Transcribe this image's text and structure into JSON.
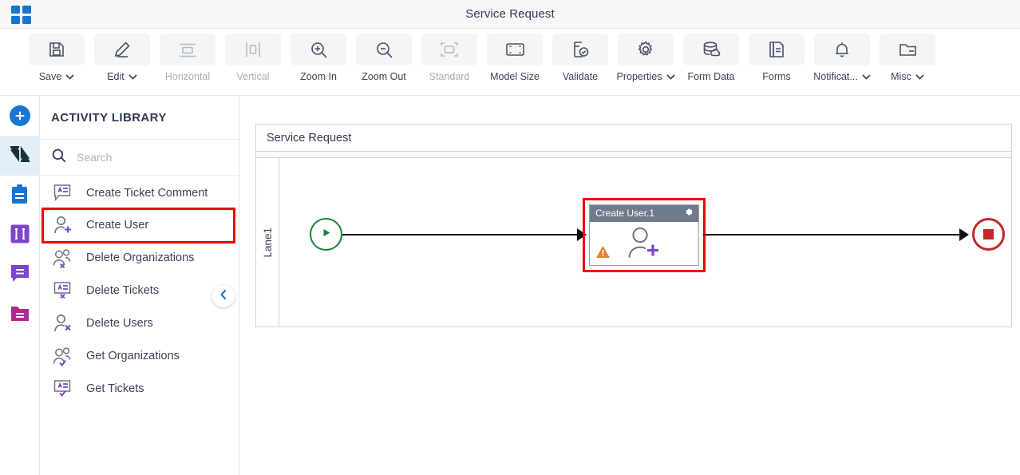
{
  "titlebar": {
    "title": "Service Request",
    "apps_icon": "apps-grid-icon"
  },
  "toolbar": {
    "buttons": [
      {
        "label": "Save",
        "icon": "save-floppy-icon",
        "dropdown": true,
        "disabled": false
      },
      {
        "label": "Edit",
        "icon": "pencil-edit-icon",
        "dropdown": true,
        "disabled": false
      },
      {
        "label": "Horizontal",
        "icon": "horizontal-align-icon",
        "dropdown": false,
        "disabled": true
      },
      {
        "label": "Vertical",
        "icon": "vertical-align-icon",
        "dropdown": false,
        "disabled": true
      },
      {
        "label": "Zoom In",
        "icon": "zoom-in-icon",
        "dropdown": false,
        "disabled": false
      },
      {
        "label": "Zoom Out",
        "icon": "zoom-out-icon",
        "dropdown": false,
        "disabled": false
      },
      {
        "label": "Standard",
        "icon": "standard-size-icon",
        "dropdown": false,
        "disabled": true
      },
      {
        "label": "Model Size",
        "icon": "model-size-icon",
        "dropdown": false,
        "disabled": false
      },
      {
        "label": "Validate",
        "icon": "validate-doc-icon",
        "dropdown": false,
        "disabled": false
      },
      {
        "label": "Properties",
        "icon": "gear-icon",
        "dropdown": true,
        "disabled": false
      },
      {
        "label": "Form Data",
        "icon": "database-icon",
        "dropdown": false,
        "disabled": false
      },
      {
        "label": "Forms",
        "icon": "document-icon",
        "dropdown": false,
        "disabled": false
      },
      {
        "label": "Notificat...",
        "icon": "bell-icon",
        "dropdown": true,
        "disabled": false
      },
      {
        "label": "Misc",
        "icon": "folder-icon",
        "dropdown": true,
        "disabled": false
      }
    ]
  },
  "rail": {
    "items": [
      {
        "name": "add-button",
        "icon": "plus-circle-icon",
        "selected": false,
        "color": "#1876d2"
      },
      {
        "name": "zendesk-connector",
        "icon": "zendesk-logo-icon",
        "selected": true,
        "color": "#17333c"
      },
      {
        "name": "tasks-clipboard",
        "icon": "clipboard-icon",
        "selected": false,
        "color": "#1876d2"
      },
      {
        "name": "columns-panel",
        "icon": "columns-icon",
        "selected": false,
        "color": "#7b46c9"
      },
      {
        "name": "messages-panel",
        "icon": "chat-bubble-icon",
        "selected": false,
        "color": "#7b46c9"
      },
      {
        "name": "files-panel",
        "icon": "folder-files-icon",
        "selected": false,
        "color": "#ae2a8c"
      }
    ]
  },
  "library": {
    "title": "ACTIVITY LIBRARY",
    "search": {
      "value": "",
      "placeholder": "Search",
      "icon": "search-icon"
    },
    "collapse_icon": "chevron-left-icon",
    "items": [
      {
        "label": "Create Ticket Comment",
        "icon": "ticket-comment-icon",
        "highlighted": false
      },
      {
        "label": "Create User",
        "icon": "user-add-icon",
        "highlighted": true
      },
      {
        "label": "Delete Organizations",
        "icon": "org-delete-icon",
        "highlighted": false
      },
      {
        "label": "Delete Tickets",
        "icon": "ticket-delete-icon",
        "highlighted": false
      },
      {
        "label": "Delete Users",
        "icon": "user-delete-icon",
        "highlighted": false
      },
      {
        "label": "Get Organizations",
        "icon": "org-get-icon",
        "highlighted": false
      },
      {
        "label": "Get Tickets",
        "icon": "ticket-get-icon",
        "highlighted": false
      }
    ]
  },
  "canvas": {
    "pool_name": "Service Request",
    "lane_name": "Lane1",
    "start_event": {
      "name": "start-event",
      "icon": "play-triangle-icon",
      "color": "#19843c"
    },
    "end_event": {
      "name": "end-event",
      "icon": "stop-square-icon",
      "color": "#c0282a"
    },
    "task": {
      "title": "Create User.1",
      "gear_icon": "gear-icon",
      "body_icon": "user-add-icon",
      "warning_icon": "warning-triangle-icon",
      "header_color": "#6f7b8c",
      "selection_color": "#ee0000",
      "warning_color": "#e8802a"
    }
  },
  "colors": {
    "accent_blue": "#1876d2",
    "annotation_red": "#ee0000",
    "purple": "#7b46c9",
    "icon_gray": "#5b6375"
  }
}
